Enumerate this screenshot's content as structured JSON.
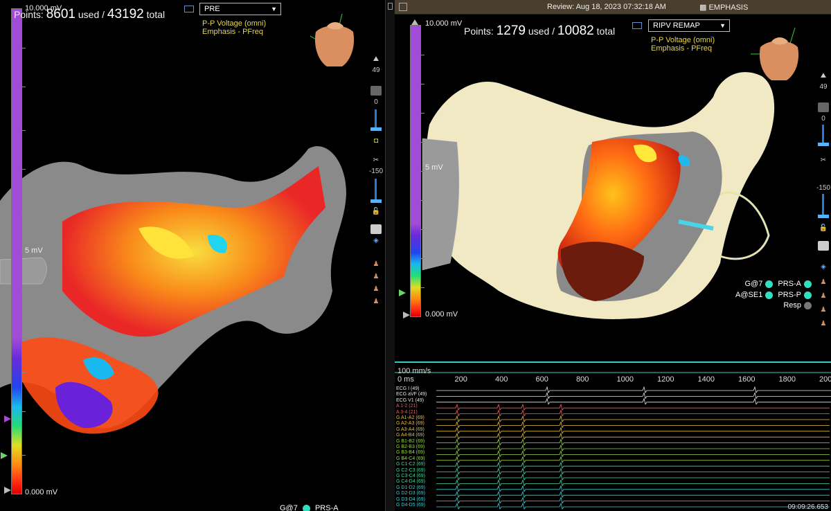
{
  "left": {
    "scale": {
      "max_label": "10.000 mV",
      "mid_label": "5 mV",
      "min_label": "0.000 mV"
    },
    "points": {
      "prefix": "Points:",
      "used": "8601",
      "used_suffix": "used /",
      "total": "43192",
      "total_suffix": "total"
    },
    "map_select": {
      "value": "PRE"
    },
    "legend": [
      "P-P Voltage (omni)",
      "Emphasis - PFreq"
    ],
    "toolbar": {
      "count1": "49",
      "count2": "0",
      "count3": "-150"
    },
    "bottom_channels": [
      "G@7",
      "PRS-A"
    ]
  },
  "right": {
    "header": {
      "review": "Review: Aug 18, 2023 07:32:18 AM",
      "app": "EMPHASIS"
    },
    "scale": {
      "max_label": "10.000 mV",
      "mid_label": "5 mV",
      "min_label": "0.000 mV"
    },
    "points": {
      "prefix": "Points:",
      "used": "1279",
      "used_suffix": "used /",
      "total": "10082",
      "total_suffix": "total"
    },
    "map_select": {
      "value": "RIPV REMAP"
    },
    "legend": [
      "P-P Voltage (omni)",
      "Emphasis - PFreq"
    ],
    "toolbar": {
      "count1": "49",
      "count2": "0",
      "count3": "-150"
    },
    "channels": [
      {
        "left": "G@7",
        "right": "PRS-A",
        "left_color": "#2ee0c0",
        "right_color": "#2ee0c0"
      },
      {
        "left": "A@SE1",
        "right": "PRS-P",
        "left_color": "#2ee0c0",
        "right_color": "#2ee0c0"
      },
      {
        "left": "",
        "right": "Resp",
        "left_color": "",
        "right_color": "#777777"
      }
    ],
    "ecg": {
      "sweep": "100 mm/s",
      "origin": "0 ms",
      "ticks": [
        "200",
        "400",
        "600",
        "800",
        "1000",
        "1200",
        "1400",
        "1600",
        "1800",
        "2000"
      ],
      "time": "09:09:26.653",
      "leads": [
        "ECG I (49)",
        "ECG aVF (49)",
        "ECG V1 (49)",
        "A 1-2 (21)",
        "A 3-4 (21)",
        "G A1-A2 (69)",
        "G A2-A3 (69)",
        "G A3-A4 (69)",
        "G A4-B4 (69)",
        "G B1-B2 (69)",
        "G B2-B3 (69)",
        "G B3-B4 (69)",
        "G B4-C4 (69)",
        "G C1-C2 (69)",
        "G C2-C3 (69)",
        "G C3-C4 (69)",
        "G C4-D4 (69)",
        "G D1-D2 (69)",
        "G D2-D3 (69)",
        "G D3-D4 (69)",
        "G D4-D5 (69)"
      ]
    }
  },
  "colors": {
    "accent": "#a24bd6",
    "legend": "#e8d84a",
    "ecg_border": "#2bd0c8",
    "tissue": "#f2ecc8",
    "scar": "#8a8a8a"
  }
}
